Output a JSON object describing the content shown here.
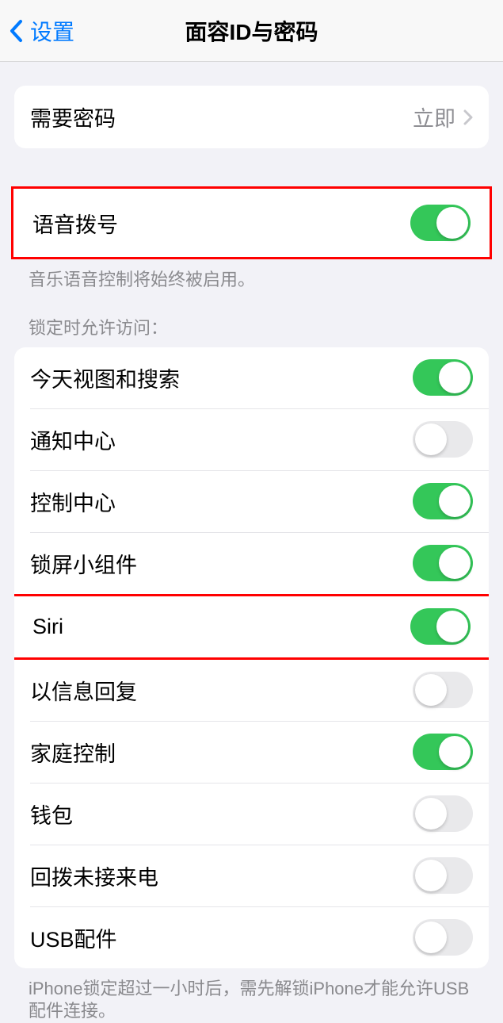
{
  "nav": {
    "back_label": "设置",
    "title": "面容ID与密码"
  },
  "passcode_group": {
    "require_label": "需要密码",
    "require_value": "立即"
  },
  "voice_dial": {
    "label": "语音拨号",
    "on": true,
    "footer": "音乐语音控制将始终被启用。"
  },
  "lock_access": {
    "header": "锁定时允许访问：",
    "items": [
      {
        "label": "今天视图和搜索",
        "on": true
      },
      {
        "label": "通知中心",
        "on": false
      },
      {
        "label": "控制中心",
        "on": true
      },
      {
        "label": "锁屏小组件",
        "on": true
      },
      {
        "label": "Siri",
        "on": true
      },
      {
        "label": "以信息回复",
        "on": false
      },
      {
        "label": "家庭控制",
        "on": true
      },
      {
        "label": "钱包",
        "on": false
      },
      {
        "label": "回拨未接来电",
        "on": false
      },
      {
        "label": "USB配件",
        "on": false
      }
    ],
    "footer": "iPhone锁定超过一小时后，需先解锁iPhone才能允许USB配件连接。"
  }
}
